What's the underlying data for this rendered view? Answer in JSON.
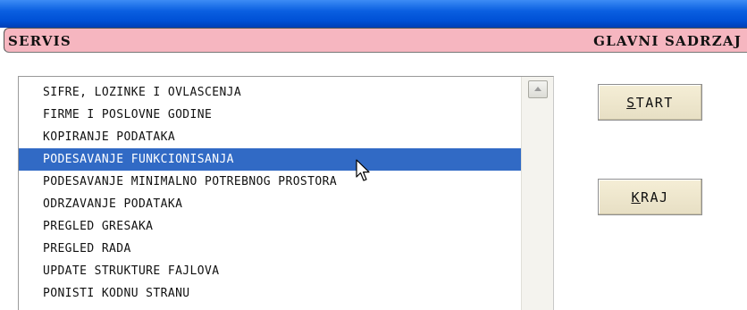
{
  "header": {
    "left_title": "SERVIS",
    "right_title": "GLAVNI SADRZAJ"
  },
  "menu": {
    "items": [
      "SIFRE, LOZINKE I OVLASCENJA",
      "FIRME I POSLOVNE GODINE",
      "KOPIRANJE PODATAKA",
      "PODESAVANJE FUNKCIONISANJA",
      "PODESAVANJE MINIMALNO POTREBNOG PROSTORA",
      "ODRZAVANJE PODATAKA",
      "PREGLED GRESAKA",
      "PREGLED RADA",
      "UPDATE STRUKTURE FAJLOVA",
      "PONISTI KODNU STRANU"
    ],
    "selected_index": 3
  },
  "buttons": {
    "start": {
      "accel": "S",
      "rest": "TART"
    },
    "kraj": {
      "accel": "K",
      "rest": "RAJ"
    }
  },
  "colors": {
    "selection": "#316ac5",
    "header": "#f6b6c0",
    "titlebar": "#0050d6",
    "button_face": "#ece5cc"
  },
  "icons": {
    "cursor": "arrow-pointer-icon",
    "scroll": "scroll-up-arrow-icon"
  }
}
